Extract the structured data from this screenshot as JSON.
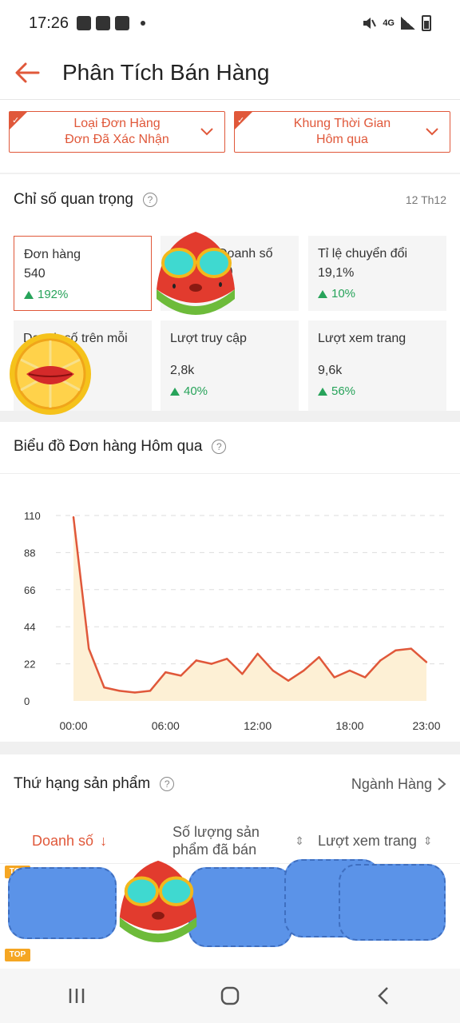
{
  "status_bar": {
    "time": "17:26",
    "network": "4G"
  },
  "header": {
    "title": "Phân Tích Bán Hàng"
  },
  "filters": [
    {
      "label": "Loại Đơn Hàng",
      "value": "Đơn Đã Xác Nhận"
    },
    {
      "label": "Khung Thời Gian",
      "value": "Hôm qua"
    }
  ],
  "key_metrics": {
    "title": "Chỉ số quan trọng",
    "date": "12 Th12",
    "items": [
      {
        "label": "Đơn hàng",
        "value": "540",
        "change": "192%"
      },
      {
        "label": "Doanh số (₫)",
        "value": "",
        "change": ""
      },
      {
        "label": "Tỉ lệ chuyển đổi",
        "value": "19,1%",
        "change": "10%"
      },
      {
        "label": "Doanh số trên mỗi đơn (₫)",
        "value": "",
        "change": ""
      },
      {
        "label": "Lượt truy cập",
        "value": "2,8k",
        "change": "40%"
      },
      {
        "label": "Lượt xem trang",
        "value": "9,6k",
        "change": "56%"
      }
    ]
  },
  "chart_section": {
    "title": "Biểu đồ Đơn hàng Hôm qua"
  },
  "chart_data": {
    "type": "area",
    "title": "Biểu đồ Đơn hàng Hôm qua",
    "x": [
      0,
      1,
      2,
      3,
      4,
      5,
      6,
      7,
      8,
      9,
      10,
      11,
      12,
      13,
      14,
      15,
      16,
      17,
      18,
      19,
      20,
      21,
      22,
      23
    ],
    "x_tick_labels": [
      "00:00",
      "06:00",
      "12:00",
      "18:00",
      "23:00"
    ],
    "x_tick_positions": [
      0,
      6,
      12,
      18,
      23
    ],
    "y_ticks": [
      0,
      22,
      44,
      66,
      88,
      110
    ],
    "ylim": [
      0,
      110
    ],
    "series": [
      {
        "values": [
          109,
          31,
          8,
          6,
          5,
          6,
          17,
          15,
          24,
          22,
          25,
          16,
          28,
          18,
          12,
          18,
          26,
          14,
          18,
          14,
          24,
          30,
          31,
          23
        ]
      }
    ],
    "colors": {
      "line": "#e0583a",
      "fill": "#fdf0d5"
    },
    "grid": true
  },
  "ranking": {
    "title": "Thứ hạng sản phẩm",
    "link": "Ngành Hàng",
    "tabs": [
      "Doanh số",
      "Số lượng sản phẩm đã bán",
      "Lượt xem trang"
    ],
    "top_badge": "TOP"
  },
  "colors": {
    "accent": "#e0583a",
    "positive": "#27a35a"
  }
}
